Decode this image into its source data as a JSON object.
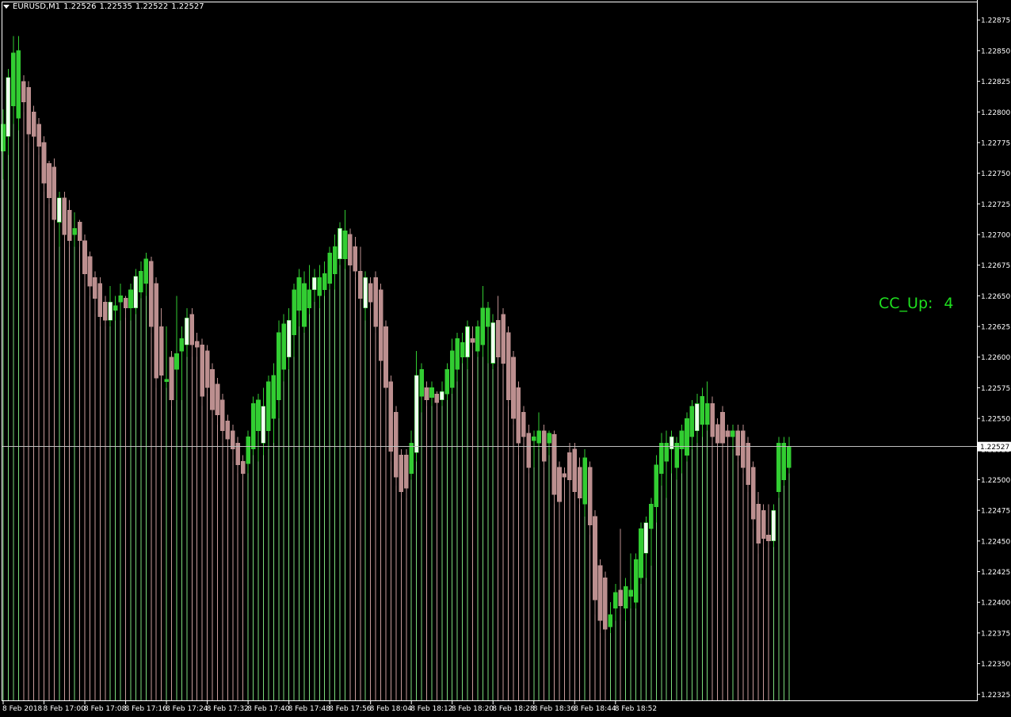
{
  "header": {
    "symbol_tf": "EURUSD,M1",
    "open": "1.22526",
    "high": "1.22535",
    "low": "1.22522",
    "close": "1.22527"
  },
  "indicator": {
    "label": "CC_Up:",
    "value": "4",
    "color": "#1fe01f"
  },
  "price_axis": {
    "ticks": [
      "1.22875",
      "1.22850",
      "1.22825",
      "1.22800",
      "1.22775",
      "1.22750",
      "1.22725",
      "1.22700",
      "1.22675",
      "1.22650",
      "1.22625",
      "1.22600",
      "1.22575",
      "1.22550",
      "1.22525",
      "1.22500",
      "1.22475",
      "1.22450",
      "1.22425",
      "1.22400",
      "1.22375",
      "1.22350",
      "1.22325"
    ],
    "current_label": "1.22527"
  },
  "time_axis": {
    "labels": [
      "8 Feb 2018",
      "8 Feb 17:00",
      "8 Feb 17:08",
      "8 Feb 17:16",
      "8 Feb 17:24",
      "8 Feb 17:32",
      "8 Feb 17:40",
      "8 Feb 17:48",
      "8 Feb 17:56",
      "8 Feb 18:04",
      "8 Feb 18:12",
      "8 Feb 18:20",
      "8 Feb 18:28",
      "8 Feb 18:36",
      "8 Feb 18:44",
      "8 Feb 18:52"
    ]
  },
  "colors": {
    "background": "#000000",
    "bull_candle": "#32cd32",
    "bear_candle": "#bc8f8f",
    "alt_bull_candle": "#f0fff0",
    "bull_volume_line": "#7cdc7c",
    "bear_volume_line": "#c89c9c",
    "axis": "#ffffff",
    "current_price_line": "#c0c0c0"
  },
  "chart_data": {
    "type": "candlestick",
    "symbol": "EURUSD",
    "timeframe": "M1",
    "ylim": [
      1.2232,
      1.2289
    ],
    "current_price": 1.22527,
    "candles": [
      {
        "o": 1.22768,
        "h": 1.22802,
        "l": 1.22745,
        "c": 1.2279
      },
      {
        "o": 1.2278,
        "h": 1.22835,
        "l": 1.22765,
        "c": 1.22828
      },
      {
        "o": 1.22805,
        "h": 1.22862,
        "l": 1.2279,
        "c": 1.22848
      },
      {
        "o": 1.22795,
        "h": 1.22862,
        "l": 1.22785,
        "c": 1.2285
      },
      {
        "o": 1.22825,
        "h": 1.2283,
        "l": 1.228,
        "c": 1.22808
      },
      {
        "o": 1.2282,
        "h": 1.22825,
        "l": 1.22775,
        "c": 1.22782
      },
      {
        "o": 1.228,
        "h": 1.22805,
        "l": 1.2277,
        "c": 1.2278
      },
      {
        "o": 1.2279,
        "h": 1.22795,
        "l": 1.22765,
        "c": 1.22772
      },
      {
        "o": 1.22775,
        "h": 1.2278,
        "l": 1.22735,
        "c": 1.22742
      },
      {
        "o": 1.22758,
        "h": 1.2276,
        "l": 1.22725,
        "c": 1.2273
      },
      {
        "o": 1.22755,
        "h": 1.22762,
        "l": 1.22705,
        "c": 1.22712
      },
      {
        "o": 1.2271,
        "h": 1.22735,
        "l": 1.2269,
        "c": 1.2273
      },
      {
        "o": 1.2273,
        "h": 1.22735,
        "l": 1.22695,
        "c": 1.227
      },
      {
        "o": 1.2272,
        "h": 1.22728,
        "l": 1.2269,
        "c": 1.22695
      },
      {
        "o": 1.227,
        "h": 1.22718,
        "l": 1.2269,
        "c": 1.22705
      },
      {
        "o": 1.2271,
        "h": 1.22712,
        "l": 1.2269,
        "c": 1.22695
      },
      {
        "o": 1.22695,
        "h": 1.227,
        "l": 1.2266,
        "c": 1.22668
      },
      {
        "o": 1.22682,
        "h": 1.22686,
        "l": 1.2265,
        "c": 1.22658
      },
      {
        "o": 1.22665,
        "h": 1.2267,
        "l": 1.22635,
        "c": 1.22648
      },
      {
        "o": 1.2266,
        "h": 1.22665,
        "l": 1.22625,
        "c": 1.22633
      },
      {
        "o": 1.22645,
        "h": 1.2265,
        "l": 1.22625,
        "c": 1.2263
      },
      {
        "o": 1.2263,
        "h": 1.22658,
        "l": 1.22625,
        "c": 1.22645
      },
      {
        "o": 1.22638,
        "h": 1.2265,
        "l": 1.2263,
        "c": 1.22642
      },
      {
        "o": 1.22645,
        "h": 1.2266,
        "l": 1.2263,
        "c": 1.2265
      },
      {
        "o": 1.22648,
        "h": 1.2265,
        "l": 1.22632,
        "c": 1.2264
      },
      {
        "o": 1.2264,
        "h": 1.2266,
        "l": 1.2263,
        "c": 1.22655
      },
      {
        "o": 1.2264,
        "h": 1.22672,
        "l": 1.22635,
        "c": 1.22666
      },
      {
        "o": 1.22653,
        "h": 1.22678,
        "l": 1.22648,
        "c": 1.2267
      },
      {
        "o": 1.2266,
        "h": 1.22685,
        "l": 1.2265,
        "c": 1.2268
      },
      {
        "o": 1.22678,
        "h": 1.22682,
        "l": 1.2262,
        "c": 1.22625
      },
      {
        "o": 1.2266,
        "h": 1.22665,
        "l": 1.22575,
        "c": 1.22583
      },
      {
        "o": 1.22625,
        "h": 1.2264,
        "l": 1.2258,
        "c": 1.22585
      },
      {
        "o": 1.2258,
        "h": 1.22625,
        "l": 1.22575,
        "c": 1.22582
      },
      {
        "o": 1.226,
        "h": 1.22605,
        "l": 1.2256,
        "c": 1.22565
      },
      {
        "o": 1.2259,
        "h": 1.2265,
        "l": 1.22565,
        "c": 1.22603
      },
      {
        "o": 1.22605,
        "h": 1.22625,
        "l": 1.22565,
        "c": 1.22615
      },
      {
        "o": 1.2261,
        "h": 1.2264,
        "l": 1.226,
        "c": 1.22632
      },
      {
        "o": 1.22635,
        "h": 1.2264,
        "l": 1.226,
        "c": 1.2261
      },
      {
        "o": 1.22613,
        "h": 1.2262,
        "l": 1.226,
        "c": 1.22608
      },
      {
        "o": 1.2261,
        "h": 1.22615,
        "l": 1.2256,
        "c": 1.22568
      },
      {
        "o": 1.22605,
        "h": 1.2261,
        "l": 1.2257,
        "c": 1.22575
      },
      {
        "o": 1.2259,
        "h": 1.22595,
        "l": 1.2255,
        "c": 1.22557
      },
      {
        "o": 1.22578,
        "h": 1.22583,
        "l": 1.22545,
        "c": 1.22553
      },
      {
        "o": 1.22565,
        "h": 1.2257,
        "l": 1.2253,
        "c": 1.2254
      },
      {
        "o": 1.22548,
        "h": 1.22553,
        "l": 1.22525,
        "c": 1.22533
      },
      {
        "o": 1.2254,
        "h": 1.22545,
        "l": 1.22515,
        "c": 1.22525
      },
      {
        "o": 1.2253,
        "h": 1.22535,
        "l": 1.22505,
        "c": 1.22512
      },
      {
        "o": 1.22515,
        "h": 1.2252,
        "l": 1.225,
        "c": 1.22505
      },
      {
        "o": 1.22513,
        "h": 1.2254,
        "l": 1.22505,
        "c": 1.22535
      },
      {
        "o": 1.22525,
        "h": 1.22568,
        "l": 1.2252,
        "c": 1.22562
      },
      {
        "o": 1.2254,
        "h": 1.2257,
        "l": 1.22515,
        "c": 1.22565
      },
      {
        "o": 1.2253,
        "h": 1.22575,
        "l": 1.2252,
        "c": 1.2256
      },
      {
        "o": 1.2254,
        "h": 1.22585,
        "l": 1.22525,
        "c": 1.2258
      },
      {
        "o": 1.2255,
        "h": 1.22595,
        "l": 1.2253,
        "c": 1.22585
      },
      {
        "o": 1.22565,
        "h": 1.2263,
        "l": 1.2255,
        "c": 1.2262
      },
      {
        "o": 1.2259,
        "h": 1.22635,
        "l": 1.2258,
        "c": 1.22627
      },
      {
        "o": 1.226,
        "h": 1.2264,
        "l": 1.2259,
        "c": 1.2263
      },
      {
        "o": 1.22618,
        "h": 1.2266,
        "l": 1.226,
        "c": 1.22655
      },
      {
        "o": 1.22638,
        "h": 1.22672,
        "l": 1.22625,
        "c": 1.22665
      },
      {
        "o": 1.22625,
        "h": 1.2267,
        "l": 1.2262,
        "c": 1.2266
      },
      {
        "o": 1.2264,
        "h": 1.22675,
        "l": 1.22635,
        "c": 1.22655
      },
      {
        "o": 1.22655,
        "h": 1.22672,
        "l": 1.22645,
        "c": 1.22665
      },
      {
        "o": 1.2265,
        "h": 1.22675,
        "l": 1.2264,
        "c": 1.22665
      },
      {
        "o": 1.22655,
        "h": 1.22678,
        "l": 1.2265,
        "c": 1.22668
      },
      {
        "o": 1.2266,
        "h": 1.2269,
        "l": 1.22655,
        "c": 1.22685
      },
      {
        "o": 1.22668,
        "h": 1.227,
        "l": 1.22655,
        "c": 1.2269
      },
      {
        "o": 1.2268,
        "h": 1.2271,
        "l": 1.22675,
        "c": 1.22705
      },
      {
        "o": 1.2268,
        "h": 1.2272,
        "l": 1.22672,
        "c": 1.22703
      },
      {
        "o": 1.227,
        "h": 1.22705,
        "l": 1.2267,
        "c": 1.22675
      },
      {
        "o": 1.2269,
        "h": 1.22698,
        "l": 1.22665,
        "c": 1.2267
      },
      {
        "o": 1.2267,
        "h": 1.2269,
        "l": 1.2264,
        "c": 1.22648
      },
      {
        "o": 1.2264,
        "h": 1.2267,
        "l": 1.2263,
        "c": 1.22665
      },
      {
        "o": 1.2266,
        "h": 1.22665,
        "l": 1.2264,
        "c": 1.22645
      },
      {
        "o": 1.22665,
        "h": 1.2267,
        "l": 1.2262,
        "c": 1.22625
      },
      {
        "o": 1.22655,
        "h": 1.2266,
        "l": 1.2259,
        "c": 1.22597
      },
      {
        "o": 1.22625,
        "h": 1.2263,
        "l": 1.22565,
        "c": 1.22575
      },
      {
        "o": 1.2258,
        "h": 1.22585,
        "l": 1.22515,
        "c": 1.22523
      },
      {
        "o": 1.22555,
        "h": 1.2256,
        "l": 1.22495,
        "c": 1.22502
      },
      {
        "o": 1.2252,
        "h": 1.22525,
        "l": 1.22485,
        "c": 1.2249
      },
      {
        "o": 1.2252,
        "h": 1.22525,
        "l": 1.22485,
        "c": 1.22493
      },
      {
        "o": 1.22505,
        "h": 1.2254,
        "l": 1.225,
        "c": 1.2253
      },
      {
        "o": 1.22522,
        "h": 1.22605,
        "l": 1.22515,
        "c": 1.22585
      },
      {
        "o": 1.22568,
        "h": 1.22595,
        "l": 1.22555,
        "c": 1.2259
      },
      {
        "o": 1.22575,
        "h": 1.2258,
        "l": 1.2256,
        "c": 1.22565
      },
      {
        "o": 1.22567,
        "h": 1.2258,
        "l": 1.2256,
        "c": 1.22575
      },
      {
        "o": 1.2257,
        "h": 1.22572,
        "l": 1.2256,
        "c": 1.22563
      },
      {
        "o": 1.22565,
        "h": 1.2258,
        "l": 1.2256,
        "c": 1.22572
      },
      {
        "o": 1.2257,
        "h": 1.22595,
        "l": 1.22565,
        "c": 1.2259
      },
      {
        "o": 1.22575,
        "h": 1.22615,
        "l": 1.2257,
        "c": 1.22605
      },
      {
        "o": 1.2259,
        "h": 1.2262,
        "l": 1.2258,
        "c": 1.22615
      },
      {
        "o": 1.226,
        "h": 1.2262,
        "l": 1.22595,
        "c": 1.22612
      },
      {
        "o": 1.226,
        "h": 1.2263,
        "l": 1.2259,
        "c": 1.22625
      },
      {
        "o": 1.22615,
        "h": 1.22625,
        "l": 1.22605,
        "c": 1.22612
      },
      {
        "o": 1.22605,
        "h": 1.2263,
        "l": 1.226,
        "c": 1.22625
      },
      {
        "o": 1.2261,
        "h": 1.22658,
        "l": 1.226,
        "c": 1.2264
      },
      {
        "o": 1.22625,
        "h": 1.22645,
        "l": 1.22595,
        "c": 1.2264
      },
      {
        "o": 1.22595,
        "h": 1.22635,
        "l": 1.2259,
        "c": 1.22628
      },
      {
        "o": 1.2263,
        "h": 1.2265,
        "l": 1.22592,
        "c": 1.226
      },
      {
        "o": 1.22635,
        "h": 1.2264,
        "l": 1.2259,
        "c": 1.22595
      },
      {
        "o": 1.2262,
        "h": 1.22625,
        "l": 1.2256,
        "c": 1.22565
      },
      {
        "o": 1.226,
        "h": 1.22605,
        "l": 1.22545,
        "c": 1.2255
      },
      {
        "o": 1.22575,
        "h": 1.2258,
        "l": 1.2252,
        "c": 1.2253
      },
      {
        "o": 1.22555,
        "h": 1.2256,
        "l": 1.2253,
        "c": 1.22535
      },
      {
        "o": 1.22538,
        "h": 1.22545,
        "l": 1.22505,
        "c": 1.2251
      },
      {
        "o": 1.22532,
        "h": 1.2254,
        "l": 1.2251,
        "c": 1.22535
      },
      {
        "o": 1.2253,
        "h": 1.22555,
        "l": 1.22525,
        "c": 1.2254
      },
      {
        "o": 1.2254,
        "h": 1.22545,
        "l": 1.2251,
        "c": 1.22515
      },
      {
        "o": 1.2253,
        "h": 1.2254,
        "l": 1.2252,
        "c": 1.22538
      },
      {
        "o": 1.22537,
        "h": 1.2254,
        "l": 1.2248,
        "c": 1.22488
      },
      {
        "o": 1.2251,
        "h": 1.22515,
        "l": 1.22475,
        "c": 1.22482
      },
      {
        "o": 1.22505,
        "h": 1.2251,
        "l": 1.225,
        "c": 1.22502
      },
      {
        "o": 1.22522,
        "h": 1.2253,
        "l": 1.225,
        "c": 1.225
      },
      {
        "o": 1.22525,
        "h": 1.2253,
        "l": 1.22485,
        "c": 1.2249
      },
      {
        "o": 1.2251,
        "h": 1.22518,
        "l": 1.2248,
        "c": 1.22485
      },
      {
        "o": 1.2248,
        "h": 1.22525,
        "l": 1.2247,
        "c": 1.22518
      },
      {
        "o": 1.2251,
        "h": 1.22515,
        "l": 1.22455,
        "c": 1.22463
      },
      {
        "o": 1.2247,
        "h": 1.22475,
        "l": 1.2239,
        "c": 1.22402
      },
      {
        "o": 1.2243,
        "h": 1.22435,
        "l": 1.22375,
        "c": 1.22385
      },
      {
        "o": 1.2242,
        "h": 1.22425,
        "l": 1.2237,
        "c": 1.22378
      },
      {
        "o": 1.2238,
        "h": 1.224,
        "l": 1.22375,
        "c": 1.2239
      },
      {
        "o": 1.22395,
        "h": 1.22415,
        "l": 1.22385,
        "c": 1.22408
      },
      {
        "o": 1.2241,
        "h": 1.2246,
        "l": 1.2239,
        "c": 1.22397
      },
      {
        "o": 1.22395,
        "h": 1.2242,
        "l": 1.22385,
        "c": 1.22413
      },
      {
        "o": 1.22405,
        "h": 1.2244,
        "l": 1.22395,
        "c": 1.2241
      },
      {
        "o": 1.224,
        "h": 1.2244,
        "l": 1.22395,
        "c": 1.22435
      },
      {
        "o": 1.2242,
        "h": 1.22465,
        "l": 1.22415,
        "c": 1.2246
      },
      {
        "o": 1.2244,
        "h": 1.2247,
        "l": 1.2242,
        "c": 1.22465
      },
      {
        "o": 1.2246,
        "h": 1.22485,
        "l": 1.2243,
        "c": 1.2248
      },
      {
        "o": 1.22478,
        "h": 1.2252,
        "l": 1.22465,
        "c": 1.22512
      },
      {
        "o": 1.22505,
        "h": 1.22538,
        "l": 1.22495,
        "c": 1.2253
      },
      {
        "o": 1.22515,
        "h": 1.2254,
        "l": 1.22485,
        "c": 1.2253
      },
      {
        "o": 1.22525,
        "h": 1.2254,
        "l": 1.22505,
        "c": 1.22535
      },
      {
        "o": 1.2251,
        "h": 1.22535,
        "l": 1.225,
        "c": 1.2253
      },
      {
        "o": 1.22525,
        "h": 1.22545,
        "l": 1.22505,
        "c": 1.2254
      },
      {
        "o": 1.2252,
        "h": 1.22555,
        "l": 1.22515,
        "c": 1.2255
      },
      {
        "o": 1.22535,
        "h": 1.22565,
        "l": 1.22525,
        "c": 1.2256
      },
      {
        "o": 1.2254,
        "h": 1.2257,
        "l": 1.2253,
        "c": 1.22562
      },
      {
        "o": 1.22545,
        "h": 1.22575,
        "l": 1.22535,
        "c": 1.22568
      },
      {
        "o": 1.22545,
        "h": 1.2258,
        "l": 1.2254,
        "c": 1.22562
      },
      {
        "o": 1.22562,
        "h": 1.22568,
        "l": 1.2253,
        "c": 1.22535
      },
      {
        "o": 1.22545,
        "h": 1.2255,
        "l": 1.22525,
        "c": 1.2253
      },
      {
        "o": 1.22555,
        "h": 1.2256,
        "l": 1.22525,
        "c": 1.2253
      },
      {
        "o": 1.2254,
        "h": 1.22545,
        "l": 1.22525,
        "c": 1.22535
      },
      {
        "o": 1.22535,
        "h": 1.22545,
        "l": 1.22525,
        "c": 1.2254
      },
      {
        "o": 1.2254,
        "h": 1.22545,
        "l": 1.22515,
        "c": 1.2252
      },
      {
        "o": 1.2254,
        "h": 1.22545,
        "l": 1.22505,
        "c": 1.2251
      },
      {
        "o": 1.2253,
        "h": 1.22535,
        "l": 1.2249,
        "c": 1.22496
      },
      {
        "o": 1.2251,
        "h": 1.22515,
        "l": 1.2246,
        "c": 1.22468
      },
      {
        "o": 1.2248,
        "h": 1.2249,
        "l": 1.2244,
        "c": 1.22448
      },
      {
        "o": 1.22475,
        "h": 1.2248,
        "l": 1.22445,
        "c": 1.22452
      },
      {
        "o": 1.22455,
        "h": 1.2248,
        "l": 1.22445,
        "c": 1.2245
      },
      {
        "o": 1.2245,
        "h": 1.2248,
        "l": 1.22445,
        "c": 1.22475
      },
      {
        "o": 1.2249,
        "h": 1.22535,
        "l": 1.22485,
        "c": 1.2253
      },
      {
        "o": 1.225,
        "h": 1.22535,
        "l": 1.22495,
        "c": 1.2253
      },
      {
        "o": 1.2251,
        "h": 1.22535,
        "l": 1.22505,
        "c": 1.22527
      }
    ]
  }
}
